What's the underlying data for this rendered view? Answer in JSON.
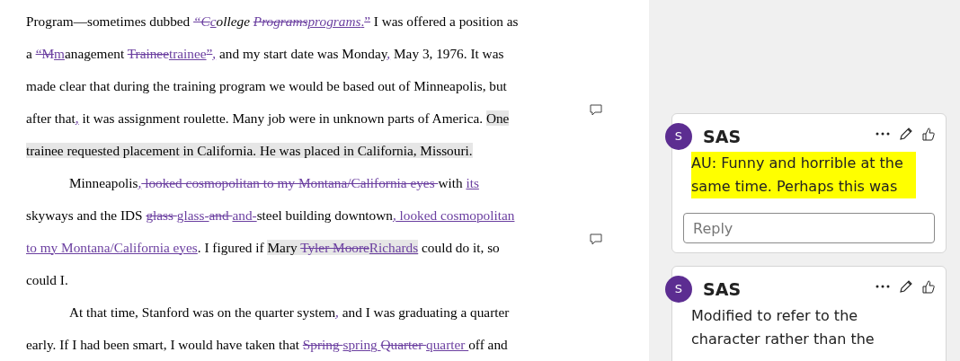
{
  "document": {
    "lines": [
      {
        "indent": false,
        "runs": [
          {
            "text": "Program—sometimes dubbed ",
            "kind": "plain"
          },
          {
            "text": "“C",
            "kind": "del-italic"
          },
          {
            "text": "c",
            "kind": "ins-italic"
          },
          {
            "text": "ollege ",
            "kind": "plain-italic"
          },
          {
            "text": "Programs",
            "kind": "del-italic"
          },
          {
            "text": "programs",
            "kind": "ins-italic"
          },
          {
            "text": ".",
            "kind": "ins"
          },
          {
            "text": "”",
            "kind": "del"
          },
          {
            "text": " I was offered a position as",
            "kind": "plain"
          }
        ]
      },
      {
        "indent": false,
        "runs": [
          {
            "text": "a ",
            "kind": "plain"
          },
          {
            "text": "“M",
            "kind": "del"
          },
          {
            "text": "m",
            "kind": "ins"
          },
          {
            "text": "anagement ",
            "kind": "plain"
          },
          {
            "text": "Trainee",
            "kind": "del"
          },
          {
            "text": "trainee",
            "kind": "ins"
          },
          {
            "text": "”",
            "kind": "del"
          },
          {
            "text": ",",
            "kind": "ins"
          },
          {
            "text": " and my start date was Monday",
            "kind": "plain"
          },
          {
            "text": ",",
            "kind": "ins"
          },
          {
            "text": " May 3, 1976. It was",
            "kind": "plain"
          }
        ]
      },
      {
        "indent": false,
        "runs": [
          {
            "text": "made clear that during the training program we would be based out of Minneapolis, but",
            "kind": "plain"
          }
        ]
      },
      {
        "indent": false,
        "comment_marker": true,
        "runs": [
          {
            "text": "after that",
            "kind": "plain"
          },
          {
            "text": ",",
            "kind": "ins"
          },
          {
            "text": " it was assignment roulette. Many job were in unknown parts of America. ",
            "kind": "plain"
          },
          {
            "text": "One",
            "kind": "comment"
          }
        ]
      },
      {
        "indent": false,
        "runs": [
          {
            "text": "trainee requested placement in California. He was placed in California, Missouri.",
            "kind": "comment"
          }
        ]
      },
      {
        "indent": true,
        "runs": [
          {
            "text": "Minneapolis",
            "kind": "plain"
          },
          {
            "text": ",",
            "kind": "ins"
          },
          {
            "text": " looked cosmopolitan to my Montana/California eyes ",
            "kind": "del"
          },
          {
            "text": "with ",
            "kind": "plain"
          },
          {
            "text": "its",
            "kind": "ins"
          }
        ]
      },
      {
        "indent": false,
        "runs": [
          {
            "text": "skyways and the IDS ",
            "kind": "plain"
          },
          {
            "text": "glass ",
            "kind": "del"
          },
          {
            "text": "glass-",
            "kind": "ins"
          },
          {
            "text": "and ",
            "kind": "del"
          },
          {
            "text": "and-",
            "kind": "ins"
          },
          {
            "text": "steel building downtown",
            "kind": "plain"
          },
          {
            "text": ",",
            "kind": "ins"
          },
          {
            "text": " looked cosmopolitan",
            "kind": "ins"
          }
        ]
      },
      {
        "indent": false,
        "comment_marker": true,
        "runs": [
          {
            "text": "to my Montana/California eyes",
            "kind": "ins"
          },
          {
            "text": ". I figured if ",
            "kind": "plain"
          },
          {
            "text": "Mary ",
            "kind": "comment"
          },
          {
            "text": "Tyler Moore",
            "kind": "comment-del"
          },
          {
            "text": "Richards",
            "kind": "comment-ins"
          },
          {
            "text": " could do it, so",
            "kind": "plain"
          }
        ]
      },
      {
        "indent": false,
        "runs": [
          {
            "text": "could I.",
            "kind": "plain"
          }
        ]
      },
      {
        "indent": true,
        "runs": [
          {
            "text": "At that time, Stanford was on the quarter system",
            "kind": "plain"
          },
          {
            "text": ",",
            "kind": "ins"
          },
          {
            "text": " and I was graduating a quarter",
            "kind": "plain"
          }
        ]
      },
      {
        "indent": false,
        "runs": [
          {
            "text": "early. If I had been smart, I would have taken that ",
            "kind": "plain"
          },
          {
            "text": "Spring ",
            "kind": "del"
          },
          {
            "text": "spring ",
            "kind": "ins"
          },
          {
            "text": "Quarter ",
            "kind": "del"
          },
          {
            "text": "quarter ",
            "kind": "ins"
          },
          {
            "text": "off and",
            "kind": "plain"
          }
        ]
      }
    ]
  },
  "comments": [
    {
      "avatar": "S",
      "author": "SAS",
      "highlighted": true,
      "text": "AU: Funny and horrible at the same time. Perhaps this was",
      "reply_placeholder": "Reply"
    },
    {
      "avatar": "S",
      "author": "SAS",
      "highlighted": false,
      "text": "Modified to refer to the character rather than the"
    }
  ]
}
